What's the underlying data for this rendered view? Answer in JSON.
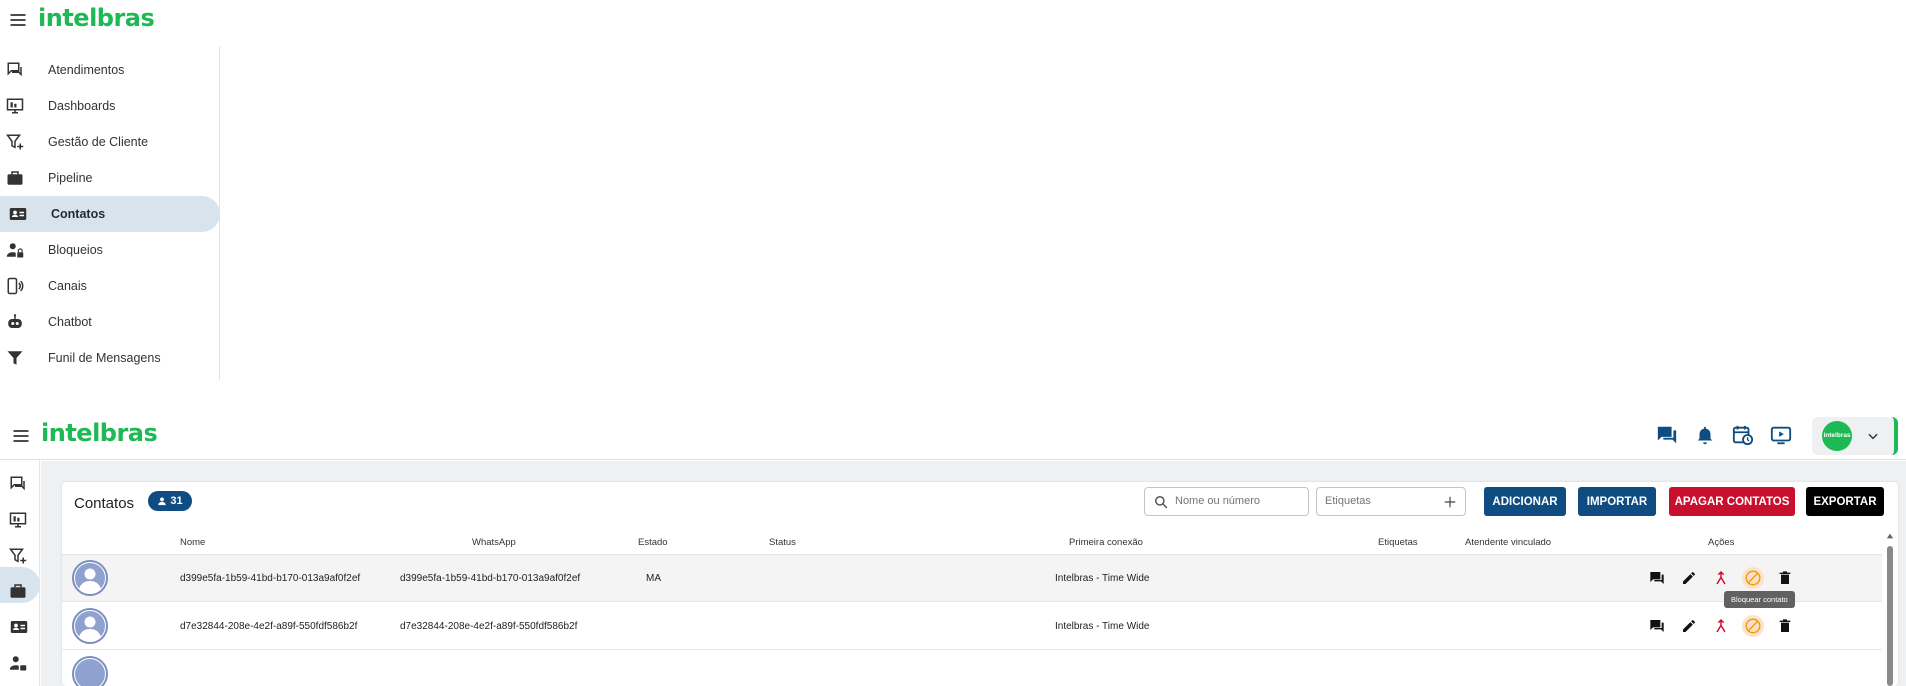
{
  "brand": {
    "logo_text": "intelbras",
    "color": "#1db954"
  },
  "sidebar": {
    "items": [
      {
        "label": "Atendimentos",
        "icon": "chat-icon"
      },
      {
        "label": "Dashboards",
        "icon": "dashboard-monitor-icon"
      },
      {
        "label": "Gestão de Cliente",
        "icon": "filter-add-icon"
      },
      {
        "label": "Pipeline",
        "icon": "briefcase-icon"
      },
      {
        "label": "Contatos",
        "icon": "contact-card-icon",
        "active": true
      },
      {
        "label": "Bloqueios",
        "icon": "user-lock-icon"
      },
      {
        "label": "Canais",
        "icon": "phone-channel-icon"
      },
      {
        "label": "Chatbot",
        "icon": "robot-icon"
      },
      {
        "label": "Funil de Mensagens",
        "icon": "funnel-icon"
      }
    ],
    "active_color": "#d7e4ee"
  },
  "topbar": {
    "icons": [
      "messages-icon",
      "bell-icon",
      "calendar-clock-icon",
      "video-play-icon"
    ],
    "user_avatar_text": "intelbras"
  },
  "contacts": {
    "title": "Contatos",
    "count": "31",
    "search_placeholder": "Nome ou número",
    "tags_placeholder": "Etiquetas",
    "buttons": {
      "add": "Adicionar",
      "import": "Importar",
      "delete_all": "Apagar contatos",
      "export": "Exportar"
    },
    "button_colors": {
      "add": "#0f4c81",
      "import": "#0f4c81",
      "delete_all": "#c8102e",
      "export": "#000000"
    },
    "columns": {
      "name": "Nome",
      "whatsapp": "WhatsApp",
      "state": "Estado",
      "status": "Status",
      "first_connection": "Primeira conexão",
      "tags": "Etiquetas",
      "agent": "Atendente vinculado",
      "actions": "Ações"
    },
    "rows": [
      {
        "name": "d399e5fa-1b59-41bd-b170-013a9af0f2ef",
        "whatsapp": "d399e5fa-1b59-41bd-b170-013a9af0f2ef",
        "state": "MA",
        "status": "",
        "first_connection": "Intelbras - Time Wide",
        "tags": "",
        "agent": ""
      },
      {
        "name": "d7e32844-208e-4e2f-a89f-550fdf586b2f",
        "whatsapp": "d7e32844-208e-4e2f-a89f-550fdf586b2f",
        "state": "",
        "status": "",
        "first_connection": "Intelbras - Time Wide",
        "tags": "",
        "agent": ""
      }
    ],
    "tooltip": "Bloquear contato"
  }
}
